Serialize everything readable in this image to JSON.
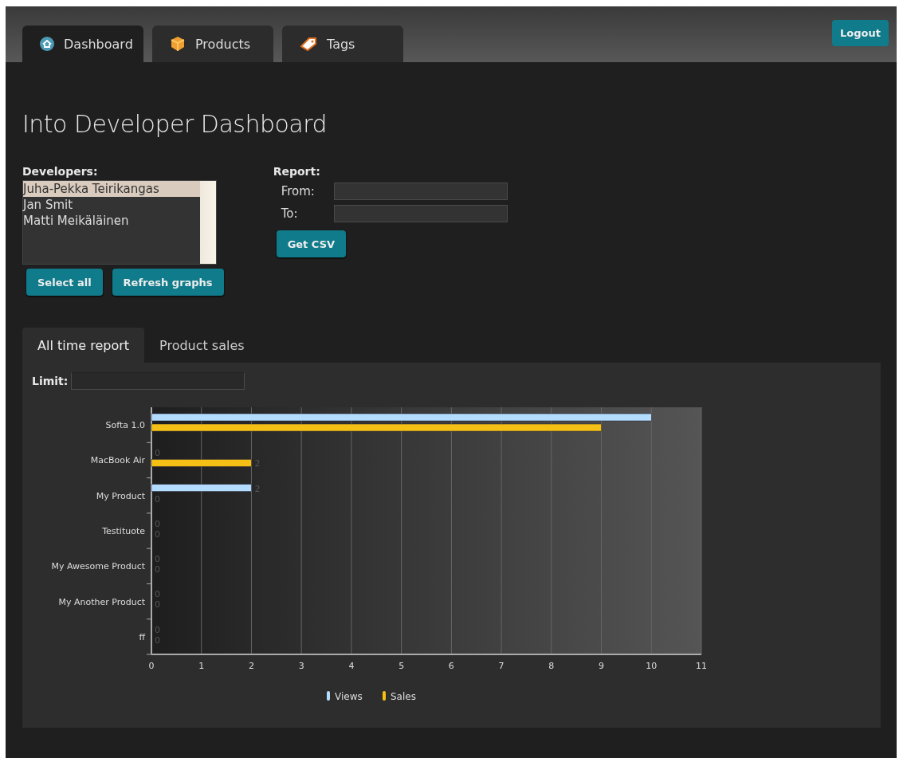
{
  "nav_tabs": [
    {
      "label": "Dashboard",
      "selected": true
    },
    {
      "label": "Products",
      "selected": false
    },
    {
      "label": "Tags",
      "selected": false
    }
  ],
  "logout_button": "Logout",
  "page_title": "Into Developer Dashboard",
  "developers": {
    "label": "Developers:",
    "items": [
      {
        "name": "Juha-Pekka Teirikangas",
        "selected": true
      },
      {
        "name": "Jan Smit",
        "selected": false
      },
      {
        "name": "Matti Meikäläinen",
        "selected": false
      }
    ],
    "buttons": [
      "Select all",
      "Refresh graphs"
    ]
  },
  "report": {
    "label": "Report:",
    "fields": [
      {
        "label": "From:"
      },
      {
        "label": "To:"
      }
    ],
    "button": "Get CSV"
  },
  "report_tabs": [
    {
      "label": "All time report",
      "selected": true
    },
    {
      "label": "Product sales",
      "selected": false
    }
  ],
  "limit": {
    "label": "Limit:"
  },
  "chart_data": {
    "type": "bar",
    "orientation": "horizontal",
    "categories": [
      "Softa 1.0",
      "MacBook Air",
      "My Product",
      "Testituote",
      "My Awesome Product",
      "My Another Product",
      "ff"
    ],
    "series": [
      {
        "name": "Views",
        "color": "#b3dcff",
        "values": [
          10,
          0,
          2,
          0,
          0,
          0,
          0
        ]
      },
      {
        "name": "Sales",
        "color": "#f5c015",
        "values": [
          9,
          2,
          0,
          0,
          0,
          0,
          0
        ]
      }
    ],
    "grid": true,
    "xlim": [
      0,
      11
    ],
    "xticks": [
      0,
      1,
      2,
      3,
      4,
      5,
      6,
      7,
      8,
      9,
      10,
      11
    ],
    "value_labels": [
      [
        null,
        "0",
        "2",
        "0",
        "0",
        "0",
        "0"
      ],
      [
        null,
        "2",
        "0",
        "0",
        "0",
        "0",
        "0"
      ]
    ]
  }
}
